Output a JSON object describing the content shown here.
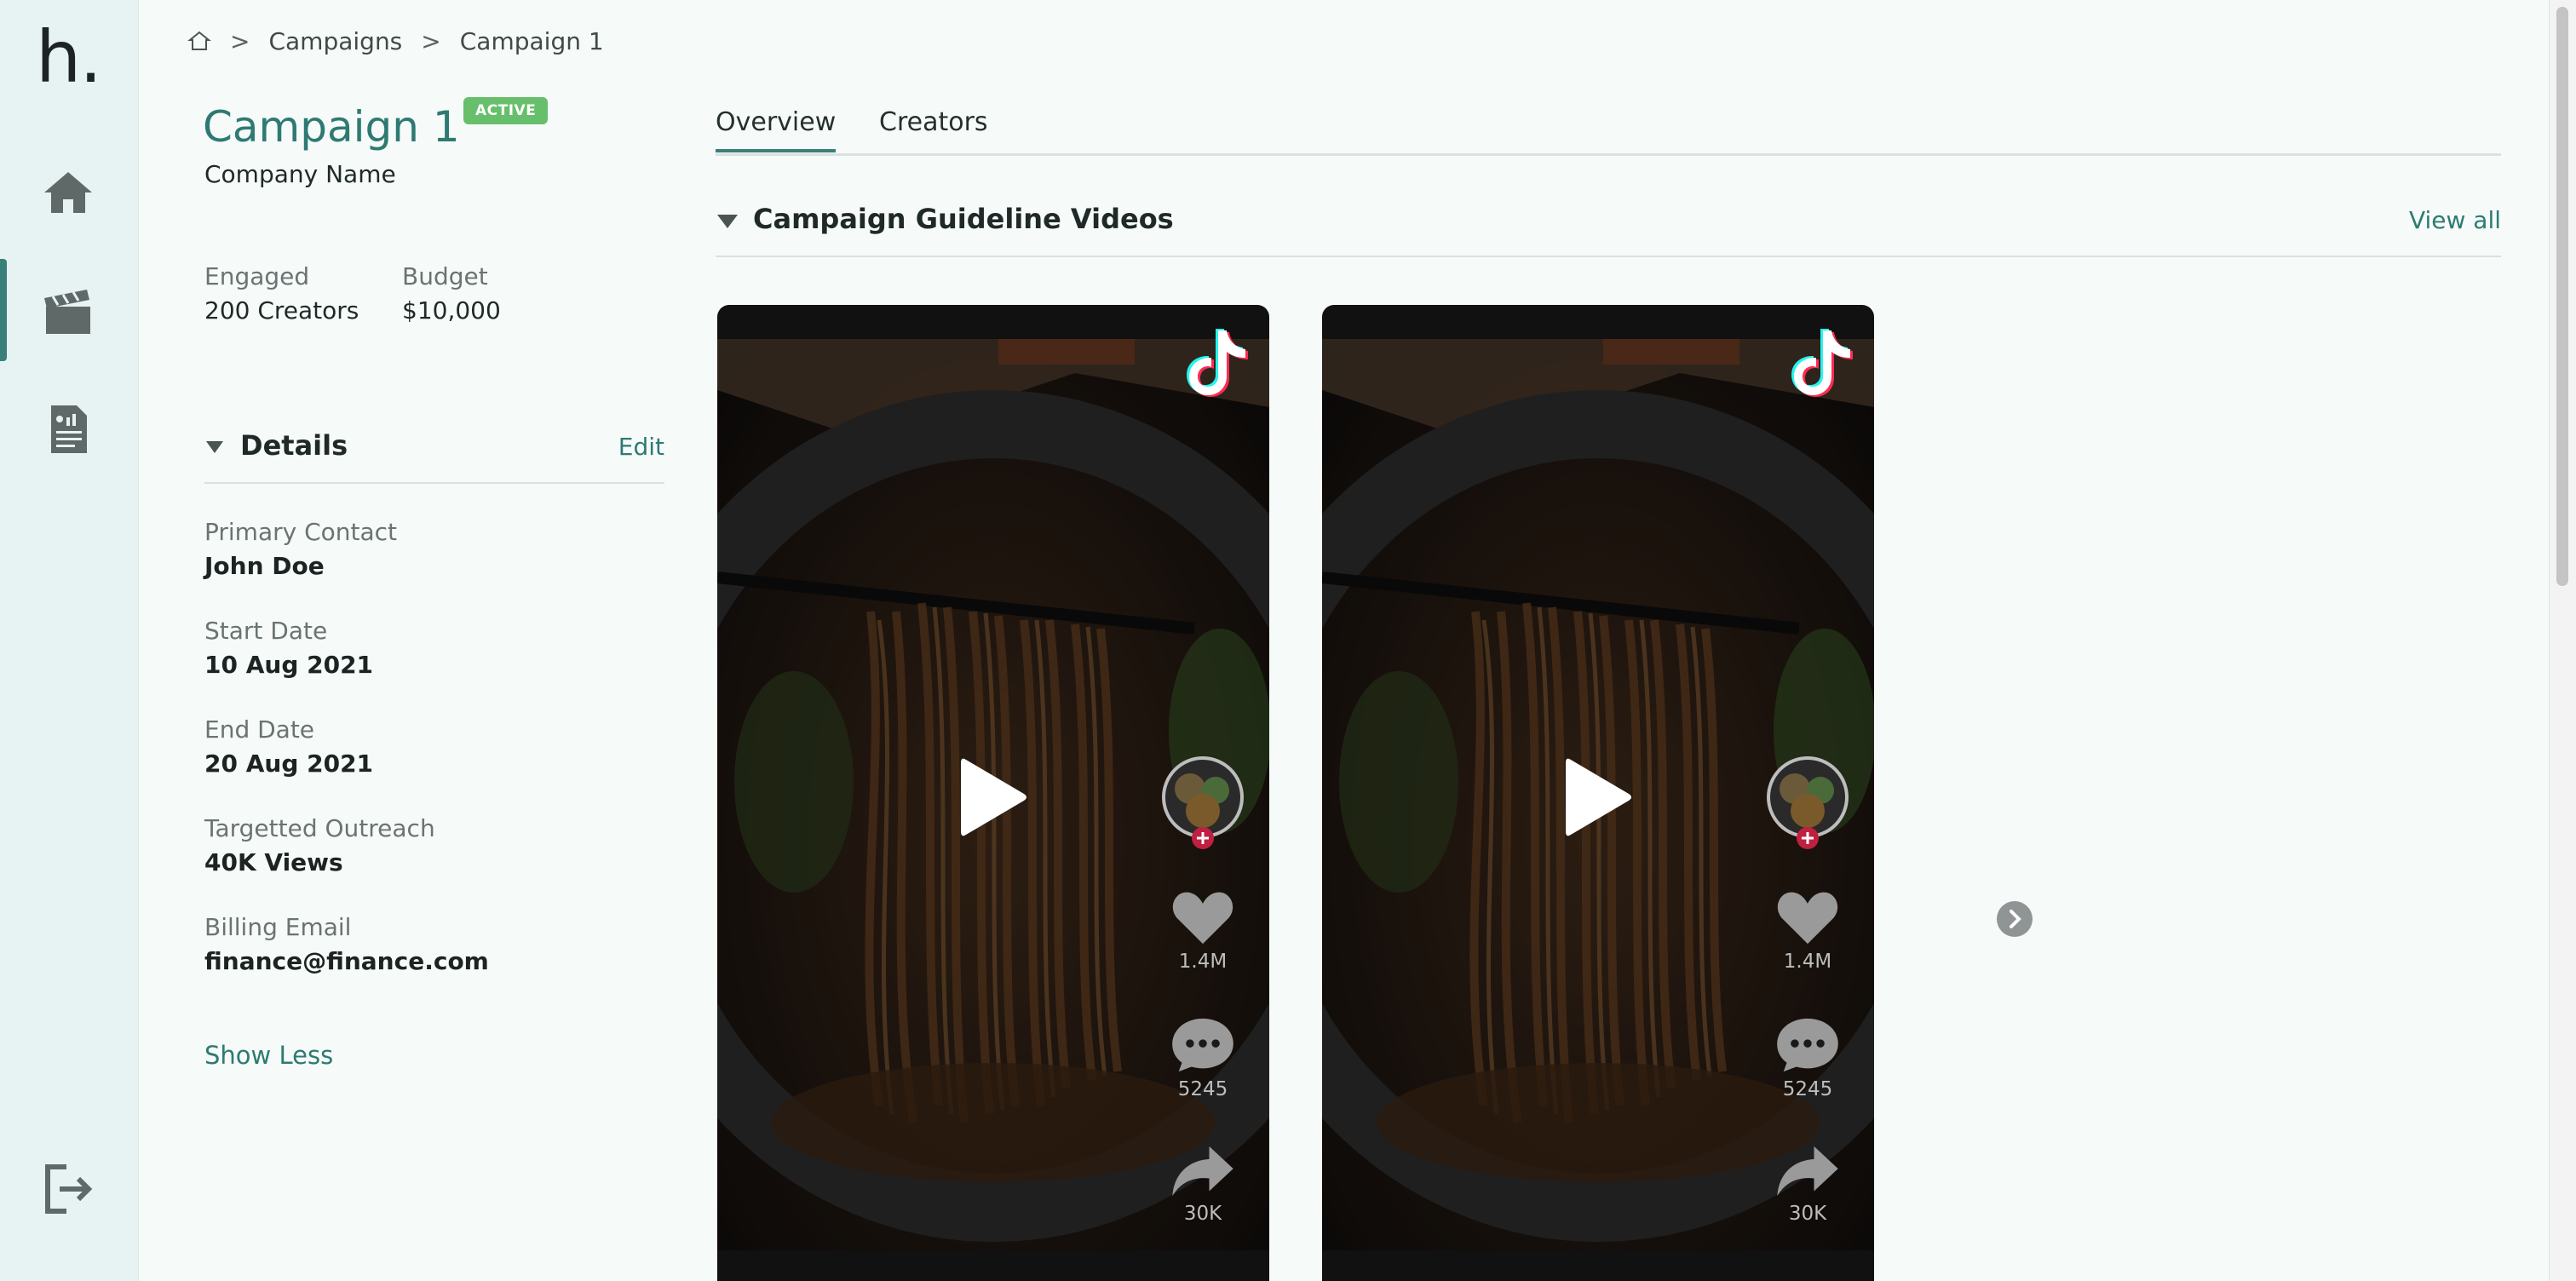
{
  "logo": "h.",
  "breadcrumb": {
    "items": [
      "Campaigns",
      "Campaign 1"
    ],
    "separator": ">"
  },
  "campaign": {
    "title": "Campaign 1",
    "status": "ACTIVE",
    "company": "Company Name",
    "engaged_label": "Engaged",
    "engaged_value": "200 Creators",
    "budget_label": "Budget",
    "budget_value": "$10,000"
  },
  "details": {
    "title": "Details",
    "edit_label": "Edit",
    "fields": [
      {
        "label": "Primary Contact",
        "value": "John Doe"
      },
      {
        "label": "Start Date",
        "value": "10 Aug 2021"
      },
      {
        "label": "End Date",
        "value": "20 Aug 2021"
      },
      {
        "label": "Targetted Outreach",
        "value": "40K Views"
      },
      {
        "label": "Billing Email",
        "value": "finance@finance.com"
      }
    ],
    "toggle_label": "Show Less"
  },
  "tabs": [
    {
      "label": "Overview",
      "active": true
    },
    {
      "label": "Creators",
      "active": false
    }
  ],
  "section": {
    "title": "Campaign Guideline Videos",
    "view_all": "View all"
  },
  "videos": [
    {
      "likes": "1.4M",
      "comments": "5245",
      "shares": "30K"
    },
    {
      "likes": "1.4M",
      "comments": "5245",
      "shares": "30K"
    }
  ],
  "colors": {
    "accent": "#2e7a72",
    "badge": "#67bf6b",
    "sidebar": "#e7f3f2"
  },
  "icons": [
    "home-icon",
    "clapperboard-icon",
    "report-icon",
    "logout-icon",
    "tiktok-icon",
    "play-icon",
    "heart-icon",
    "comment-icon",
    "share-icon",
    "chevron-right-icon"
  ]
}
